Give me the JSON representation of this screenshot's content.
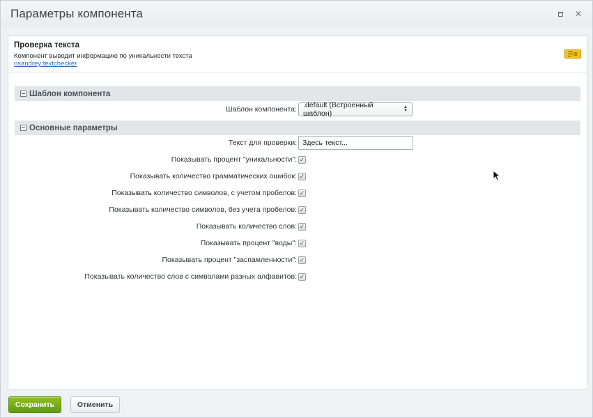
{
  "window": {
    "title": "Параметры компонента"
  },
  "component": {
    "name": "Проверка текста",
    "description": "Компонент выводит информацию по уникальности текста",
    "code": "nsandrey:textchecker"
  },
  "sections": {
    "template": {
      "title": "Шаблон компонента",
      "label": "Шаблон компонента:",
      "selected": ".default (Встроенный шаблон)"
    },
    "main": {
      "title": "Основные параметры",
      "text_label": "Текст для проверки:",
      "text_value": "Здесь текст...",
      "checkboxes": [
        {
          "label": "Показывать процент \"уникальности\":",
          "checked": true
        },
        {
          "label": "Показывать количество грамматических ошибок:",
          "checked": true
        },
        {
          "label": "Показывать количество символов, с учетом пробелов:",
          "checked": true
        },
        {
          "label": "Показывать количество символов, без учета пробелов:",
          "checked": true
        },
        {
          "label": "Показывать количество слов:",
          "checked": true
        },
        {
          "label": "Показывать процент \"воды\":",
          "checked": true
        },
        {
          "label": "Показывать процент \"заспамленности\":",
          "checked": true
        },
        {
          "label": "Показывать количество слов с символами разных алфавитов:",
          "checked": true
        }
      ]
    }
  },
  "footer": {
    "save_label": "Сохранить",
    "cancel_label": "Отменить"
  },
  "colors": {
    "save_button": "#7cb41d",
    "link": "#2a6fbf",
    "help_badge": "#f5c518"
  },
  "icons": {
    "maximize": "maximize-icon",
    "close": "close-icon",
    "help": "help-badge-icon",
    "collapse": "collapse-toggle-icon",
    "cursor": "mouse-cursor-icon"
  }
}
